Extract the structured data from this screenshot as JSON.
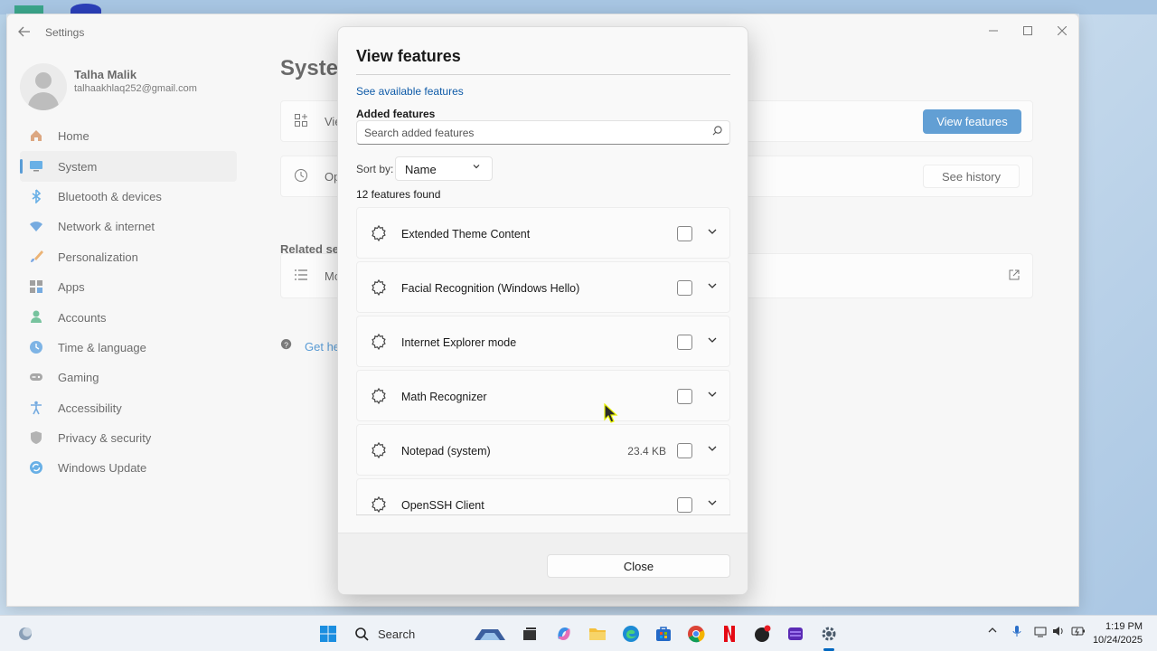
{
  "window": {
    "title": "Settings",
    "controls": [
      "minimize",
      "maximize",
      "close"
    ]
  },
  "profile": {
    "name": "Talha Malik",
    "email": "talhaakhlaq252@gmail.com"
  },
  "sidebar": {
    "items": [
      {
        "label": "Home",
        "icon": "home-icon",
        "selected": false
      },
      {
        "label": "System",
        "icon": "system-icon",
        "selected": true
      },
      {
        "label": "Bluetooth & devices",
        "icon": "bluetooth-icon",
        "selected": false
      },
      {
        "label": "Network & internet",
        "icon": "network-icon",
        "selected": false
      },
      {
        "label": "Personalization",
        "icon": "brush-icon",
        "selected": false
      },
      {
        "label": "Apps",
        "icon": "apps-icon",
        "selected": false
      },
      {
        "label": "Accounts",
        "icon": "accounts-icon",
        "selected": false
      },
      {
        "label": "Time & language",
        "icon": "clock-icon",
        "selected": false
      },
      {
        "label": "Gaming",
        "icon": "gamepad-icon",
        "selected": false
      },
      {
        "label": "Accessibility",
        "icon": "accessibility-icon",
        "selected": false
      },
      {
        "label": "Privacy & security",
        "icon": "shield-icon",
        "selected": false
      },
      {
        "label": "Windows Update",
        "icon": "update-icon",
        "selected": false
      }
    ]
  },
  "main": {
    "title": "Syster",
    "row1_label": "Vie",
    "row1_button": "View features",
    "row2_label": "Op",
    "row2_button": "See history",
    "related_title": "Related setti",
    "related_row_label": "Mo",
    "help_link": "Get hel"
  },
  "dialog": {
    "title": "View features",
    "available_link": "See available features",
    "added_title": "Added features",
    "search_placeholder": "Search added features",
    "sort_label": "Sort by:",
    "sort_value": "Name",
    "count_text": "12 features found",
    "features": [
      {
        "name": "Extended Theme Content",
        "size": "",
        "checked": false
      },
      {
        "name": "Facial Recognition (Windows Hello)",
        "size": "",
        "checked": false
      },
      {
        "name": "Internet Explorer mode",
        "size": "",
        "checked": false
      },
      {
        "name": "Math Recognizer",
        "size": "",
        "checked": false
      },
      {
        "name": "Notepad (system)",
        "size": "23.4 KB",
        "checked": false
      },
      {
        "name": "OpenSSH Client",
        "size": "",
        "checked": false
      }
    ],
    "close_label": "Close"
  },
  "taskbar": {
    "search_label": "Search",
    "time": "1:19 PM",
    "date": "10/24/2025"
  },
  "colors": {
    "accent": "#0f6cbd",
    "link": "#0f5ba8",
    "selected_indicator": "#0067c0"
  }
}
